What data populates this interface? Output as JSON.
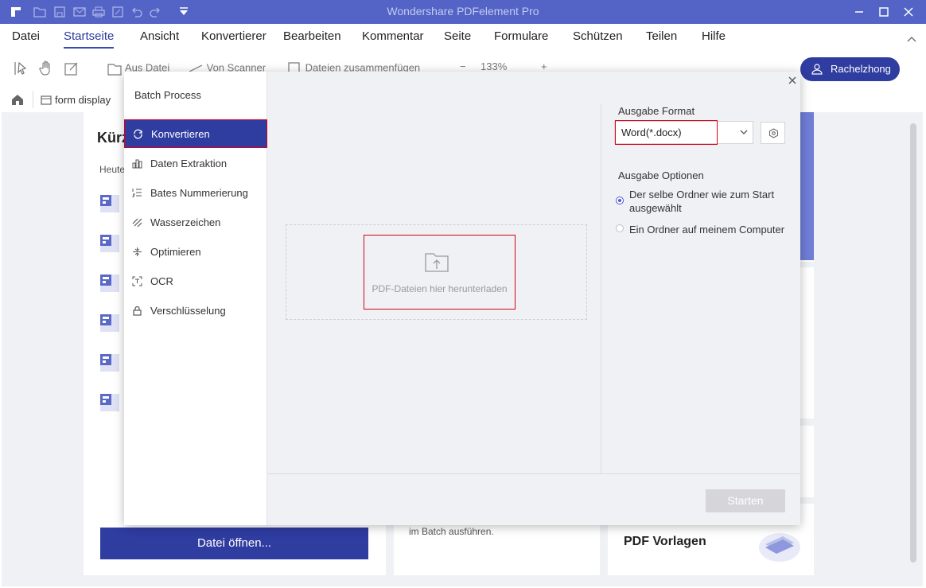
{
  "app": {
    "title": "Wondershare PDFelement Pro"
  },
  "menu": [
    "Datei",
    "Startseite",
    "Ansicht",
    "Konvertierer",
    "Bearbeiten",
    "Kommentar",
    "Seite",
    "Formulare",
    "Schützen",
    "Teilen",
    "Hilfe"
  ],
  "toolbar": {
    "from_file": "Aus Datei",
    "from_scanner": "Von Scanner",
    "merge_files": "Dateien zusammenfügen",
    "zoom": "133%"
  },
  "user": {
    "name": "Rachelzhong"
  },
  "breadcrumb": {
    "tab": "form display"
  },
  "background": {
    "heading_partial": "Kürz",
    "today_partial": "Heute",
    "open_button": "Datei öffnen...",
    "batch_text": "im Batch ausführen.",
    "templates": "PDF Vorlagen"
  },
  "modal": {
    "title": "Batch Process",
    "nav": [
      {
        "label": "Konvertieren",
        "icon": "refresh-icon"
      },
      {
        "label": "Daten Extraktion",
        "icon": "chart-icon"
      },
      {
        "label": "Bates Nummerierung",
        "icon": "list-number-icon"
      },
      {
        "label": "Wasserzeichen",
        "icon": "watermark-icon"
      },
      {
        "label": "Optimieren",
        "icon": "optimize-icon"
      },
      {
        "label": "OCR",
        "icon": "ocr-icon"
      },
      {
        "label": "Verschlüsselung",
        "icon": "lock-icon"
      }
    ],
    "drop_text": "PDF-Dateien hier herunterladen",
    "output_format_label": "Ausgabe Format",
    "output_format_value": "Word(*.docx)",
    "output_options_label": "Ausgabe Optionen",
    "option_same_line1": "Der selbe Ordner wie zum Start",
    "option_same_line2": "ausgewählt",
    "option_computer": "Ein Ordner auf meinem Computer",
    "start_button": "Starten"
  }
}
